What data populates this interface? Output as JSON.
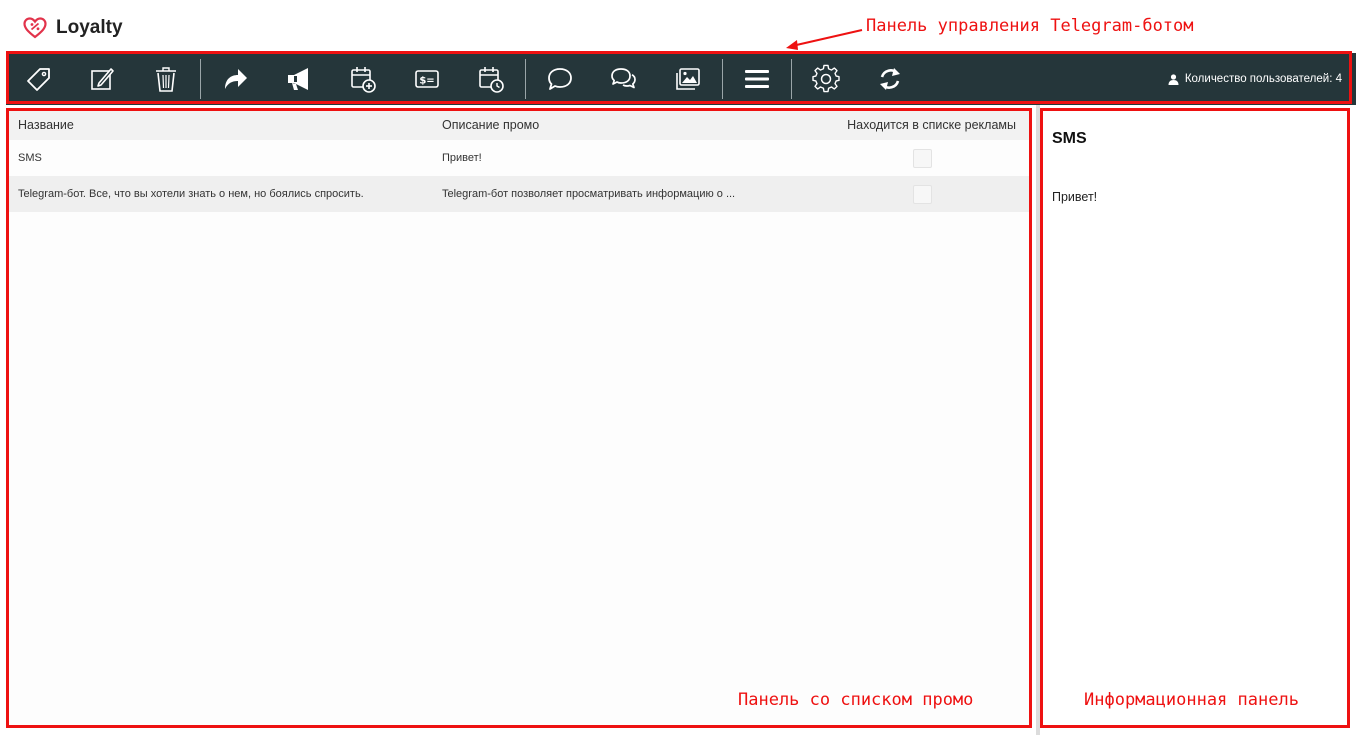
{
  "app": {
    "logo_text": "Loyalty"
  },
  "annotations": {
    "toolbar_label": "Панель управления Telegram-ботом",
    "list_label": "Панель со списком промо",
    "info_label": "Информационная панель",
    "color": "#ee1111"
  },
  "toolbar": {
    "background": "#25363a",
    "buttons": [
      {
        "icon": "tag-icon"
      },
      {
        "icon": "edit-icon"
      },
      {
        "icon": "trash-icon"
      },
      {
        "icon": "share-icon"
      },
      {
        "icon": "megaphone-icon"
      },
      {
        "icon": "calendar-add-icon"
      },
      {
        "icon": "price-tag-icon"
      },
      {
        "icon": "calendar-clock-icon"
      },
      {
        "icon": "chat-bubble-icon"
      },
      {
        "icon": "chat-bubbles-icon"
      },
      {
        "icon": "image-gallery-icon"
      },
      {
        "icon": "menu-icon"
      },
      {
        "icon": "gear-icon"
      },
      {
        "icon": "refresh-icon"
      }
    ],
    "users_label": "Количество пользователей: 4",
    "users_icon": "user-icon"
  },
  "promo_list": {
    "columns": {
      "name": "Название",
      "description": "Описание промо",
      "in_ads": "Находится в списке рекламы"
    },
    "rows": [
      {
        "name": "SMS",
        "description": "Привет!",
        "in_ads": false
      },
      {
        "name": "Telegram-бот. Все, что вы хотели знать о нем, но боялись спросить.",
        "description": "Telegram-бот позволяет просматривать информацию о ...",
        "in_ads": false
      }
    ]
  },
  "info_panel": {
    "title": "SMS",
    "body": "Привет!"
  }
}
